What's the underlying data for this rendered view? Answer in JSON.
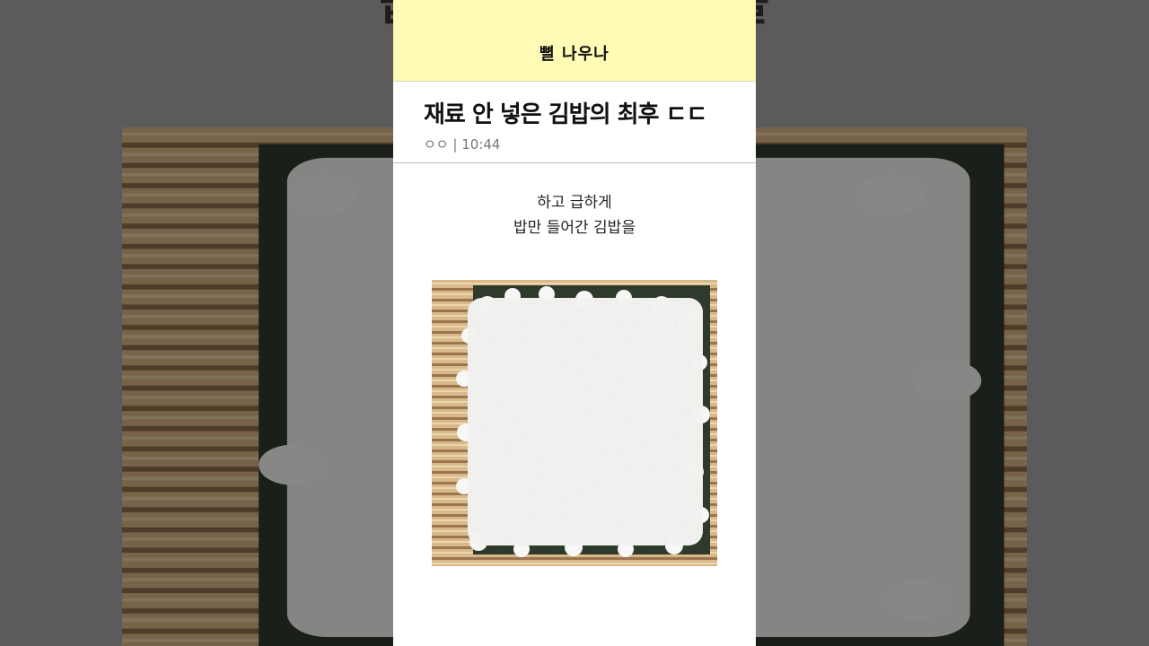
{
  "background": {
    "top_text": "밥만 들어간 김밥을"
  },
  "header": {
    "brand": "뼐 나우나"
  },
  "post": {
    "title": "재료 안 넣은 김밥의 최후 ㄷㄷ",
    "author": "ㅇㅇ",
    "separator": "|",
    "time": "10:44",
    "caption_lines": [
      "하고 급하게",
      "밥만 들어간 김밥을"
    ]
  },
  "colors": {
    "brand_bar": "#fffab6",
    "mat": "#d9b98a",
    "seaweed": "#2e3a2c",
    "rice": "#f4f4f2"
  }
}
